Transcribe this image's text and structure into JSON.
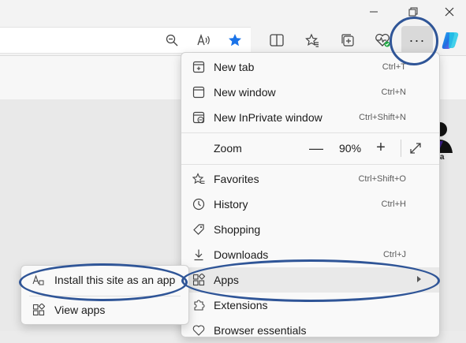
{
  "window": {
    "buttons": [
      {
        "name": "minimize",
        "icon": "minimize-icon"
      },
      {
        "name": "restore",
        "icon": "restore-icon"
      },
      {
        "name": "close",
        "icon": "close-icon"
      }
    ]
  },
  "toolbar": {
    "icons": [
      "zoom-out-icon",
      "read-aloud-icon",
      "favorite-star-icon",
      "split-screen-icon",
      "favorites-icon",
      "collections-icon",
      "browser-essentials-icon",
      "settings-more-icon",
      "copilot-icon"
    ],
    "more_label": "···",
    "star_color": "#1a73e8"
  },
  "page": {
    "avatar_label": "tka"
  },
  "menu": {
    "new_tab": {
      "label": "New tab",
      "shortcut": "Ctrl+T"
    },
    "new_window": {
      "label": "New window",
      "shortcut": "Ctrl+N"
    },
    "new_inprivate": {
      "label": "New InPrivate window",
      "shortcut": "Ctrl+Shift+N"
    },
    "zoom": {
      "label": "Zoom",
      "minus": "—",
      "value": "90%",
      "plus": "+"
    },
    "favorites": {
      "label": "Favorites",
      "shortcut": "Ctrl+Shift+O"
    },
    "history": {
      "label": "History",
      "shortcut": "Ctrl+H"
    },
    "shopping": {
      "label": "Shopping"
    },
    "downloads": {
      "label": "Downloads",
      "shortcut": "Ctrl+J"
    },
    "apps": {
      "label": "Apps"
    },
    "extensions": {
      "label": "Extensions"
    },
    "browser_essentials": {
      "label": "Browser essentials"
    }
  },
  "submenu": {
    "install": {
      "label": "Install this site as an app"
    },
    "view_apps": {
      "label": "View apps"
    }
  },
  "colors": {
    "highlight_ring": "#2f5597",
    "menu_bg": "#f9f9f9"
  }
}
